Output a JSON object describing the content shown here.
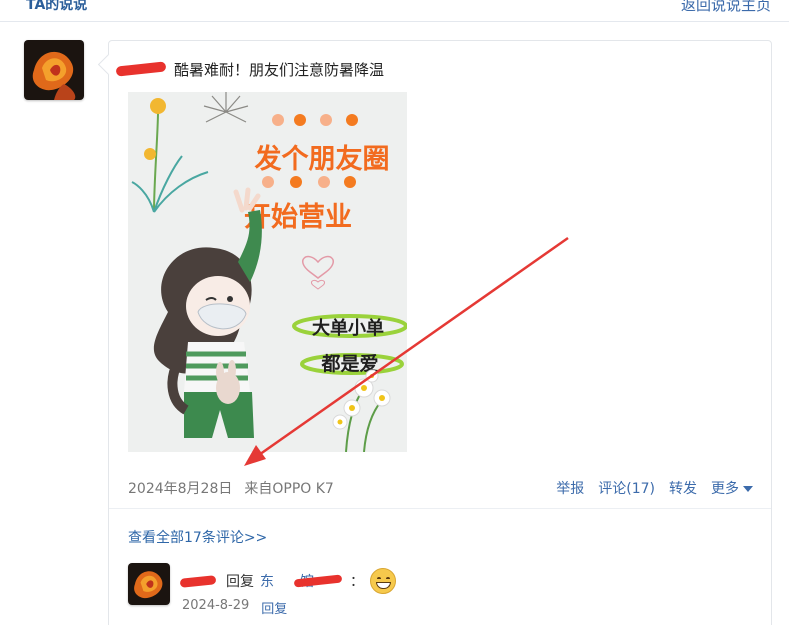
{
  "header": {
    "title": "TA的说说",
    "back_link": "返回说说主页"
  },
  "post": {
    "text": "酷暑难耐！朋友们注意防暑降温",
    "image": {
      "line1": "发个朋友圈",
      "line2": "开始营业",
      "tag1": "大单小单",
      "tag2": "都是爱"
    },
    "date": "2024年8月28日",
    "source": "来自OPPO K7",
    "actions": {
      "report": "举报",
      "comment": "评论(17)",
      "forward": "转发",
      "more": "更多"
    }
  },
  "comments": {
    "view_all": "查看全部17条评论>>",
    "items": [
      {
        "reply_label": "回复",
        "reply_target_visible": "东",
        "target_suffix": "馆",
        "separator": "：",
        "date": "2024-8-29",
        "reply_link": "回复"
      }
    ]
  },
  "colors": {
    "link": "#3c6bab",
    "redaction": "#e8322d",
    "arrow": "#e53935"
  }
}
